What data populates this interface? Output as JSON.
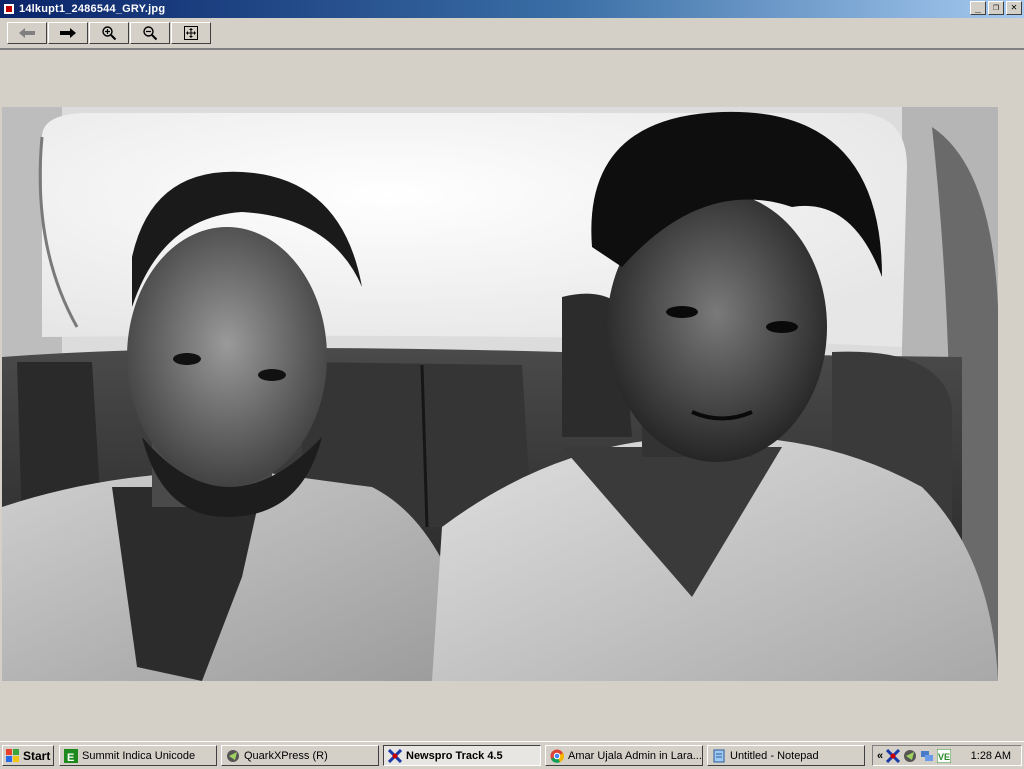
{
  "window": {
    "title": "14lkupt1_2486544_GRY.jpg",
    "minimize_glyph": "_",
    "restore_glyph": "❐",
    "close_glyph": "✕"
  },
  "toolbar": {
    "buttons": [
      {
        "icon": "arrow-left-icon"
      },
      {
        "icon": "arrow-right-icon"
      },
      {
        "icon": "zoom-in-icon"
      },
      {
        "icon": "zoom-out-icon"
      },
      {
        "icon": "fit-to-window-icon"
      }
    ]
  },
  "photo": {
    "description_icon": "photo-two-men-in-car"
  },
  "taskbar": {
    "start_label": "Start",
    "tasks": [
      {
        "label": "Summit Indica Unicode",
        "icon": "indica-icon",
        "active": false
      },
      {
        "label": "QuarkXPress (R)",
        "icon": "quark-icon",
        "active": false
      },
      {
        "label": "Newspro Track 4.5",
        "icon": "newspro-icon",
        "active": true
      },
      {
        "label": "Amar Ujala Admin in Lara...",
        "icon": "chrome-icon",
        "active": false
      },
      {
        "label": "Untitled - Notepad",
        "icon": "notepad-icon",
        "active": false
      }
    ],
    "tray": {
      "chevron": "«",
      "clock": "1:28 AM"
    }
  },
  "colors": {
    "face": "#d4d0c8",
    "titlebar_start": "#0a246a",
    "titlebar_end": "#a6caf0"
  }
}
